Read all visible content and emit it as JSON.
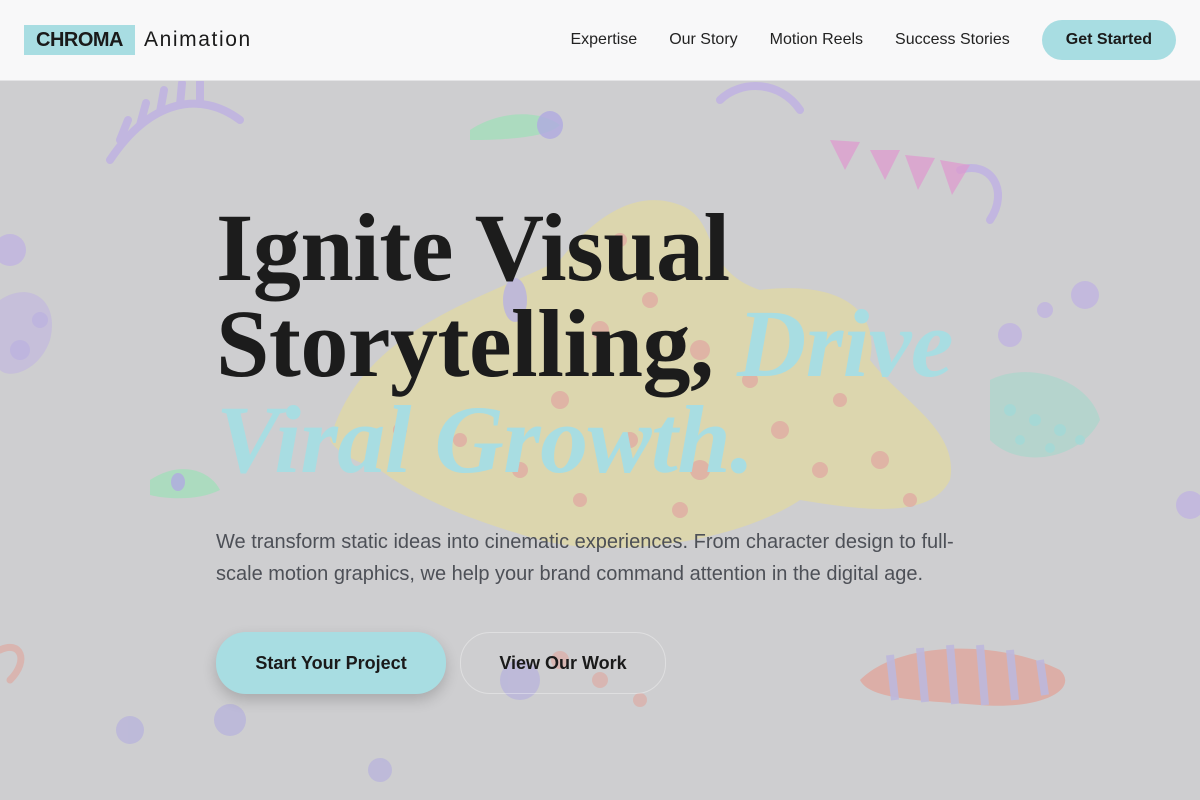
{
  "header": {
    "logo_mark": "CHROMA",
    "logo_text": "Animation",
    "nav": [
      {
        "label": "Expertise"
      },
      {
        "label": "Our Story"
      },
      {
        "label": "Motion Reels"
      },
      {
        "label": "Success Stories"
      }
    ],
    "cta_label": "Get Started"
  },
  "hero": {
    "title_line1": "Ignite Visual",
    "title_line2": "Storytelling,",
    "title_accent_1": "Drive",
    "title_accent_2": "Viral Growth.",
    "subtitle": "We transform static ideas into cinematic experiences. From character design to full-scale motion graphics, we help your brand command attention in the digital age.",
    "primary_button": "Start Your Project",
    "secondary_button": "View Our Work"
  },
  "background": {
    "image_description": "psychedelic-creatures-illustration"
  },
  "colors": {
    "accent": "#a8dde2",
    "text": "#1c1c1c",
    "muted_text": "#4d5057",
    "header_bg": "#f8f8f9",
    "hero_bg": "#cfcfd1"
  }
}
